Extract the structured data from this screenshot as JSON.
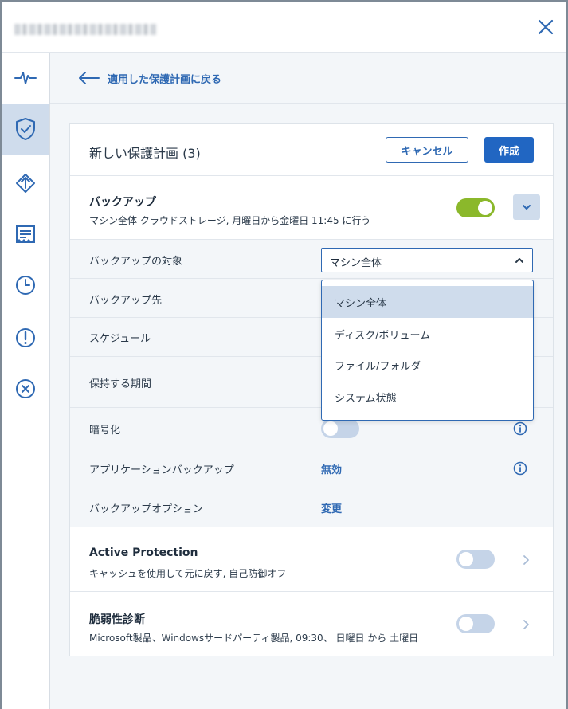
{
  "header": {
    "title_blurred": true
  },
  "sidebar": {
    "items": [
      {
        "icon": "pulse-icon"
      },
      {
        "icon": "shield-check-icon",
        "active": true
      },
      {
        "icon": "deploy-icon"
      },
      {
        "icon": "report-icon"
      },
      {
        "icon": "clock-icon"
      },
      {
        "icon": "alert-icon"
      },
      {
        "icon": "cancel-circle-icon"
      }
    ]
  },
  "nav": {
    "back_label": "適用した保護計画に戻る"
  },
  "plan": {
    "title": "新しい保護計画 (3)",
    "cancel_label": "キャンセル",
    "create_label": "作成"
  },
  "backup": {
    "title": "バックアップ",
    "summary": "マシン全体 クラウドストレージ, 月曜日から金曜日 11:45 に行う",
    "enabled": true
  },
  "settings": {
    "target_label": "バックアップの対象",
    "target_value": "マシン全体",
    "destination_label": "バックアップ先",
    "schedule_label": "スケジュール",
    "retention_label": "保持する期間",
    "encryption_label": "暗号化",
    "app_backup_label": "アプリケーションバックアップ",
    "app_backup_value": "無効",
    "options_label": "バックアップオプション",
    "options_value": "変更"
  },
  "target_dropdown": {
    "options": [
      "マシン全体",
      "ディスク/ボリューム",
      "ファイル/フォルダ",
      "システム状態"
    ],
    "selected_index": 0
  },
  "active_protection": {
    "title": "Active Protection",
    "summary": "キャッシュを使用して元に戻す, 自己防御オフ",
    "enabled": false
  },
  "vulnerability": {
    "title": "脆弱性診断",
    "summary": "Microsoft製品、Windowsサードパーティ製品, 09:30、 日曜日 から 土曜日",
    "enabled": false
  },
  "colors": {
    "accent": "#2f69b3",
    "primary_button": "#2166c2",
    "toggle_on": "#8bb82b",
    "toggle_off": "#c5d4e8",
    "active_bg": "#cfdcec"
  }
}
